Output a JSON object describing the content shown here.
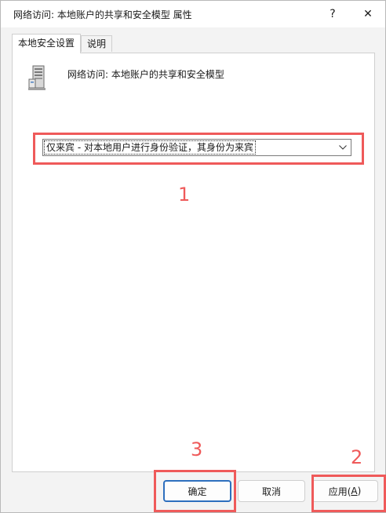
{
  "window": {
    "title": "网络访问: 本地账户的共享和安全模型 属性",
    "help_label": "?",
    "close_label": "✕"
  },
  "tabs": [
    {
      "label": "本地安全设置",
      "active": true
    },
    {
      "label": "说明",
      "active": false
    }
  ],
  "policy": {
    "icon": "server-icon",
    "title": "网络访问: 本地账户的共享和安全模型"
  },
  "dropdown": {
    "selected": "仅来宾 - 对本地用户进行身份验证，其身份为来宾",
    "arrow": "chevron-down-icon"
  },
  "annotations": [
    {
      "number": "1"
    },
    {
      "number": "2"
    },
    {
      "number": "3"
    }
  ],
  "buttons": {
    "ok": "确定",
    "cancel": "取消",
    "apply_prefix": "应用(",
    "apply_hotkey": "A",
    "apply_suffix": ")"
  },
  "colors": {
    "annotation": "#ef5a5a",
    "default_button_border": "#2d6fbe",
    "panel": "#ffffff",
    "window": "#f3f3f3"
  }
}
